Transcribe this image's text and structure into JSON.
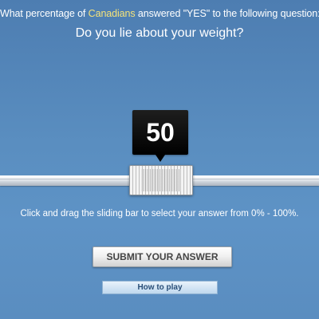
{
  "question": {
    "prefix": "What percentage of ",
    "country": "Canadians",
    "suffix": " answered \"YES\" to the following question:",
    "text": "Do you lie about your weight?"
  },
  "slider": {
    "value": 50,
    "value_label": "50",
    "min": 0,
    "max": 100
  },
  "instruction": "Click and drag the sliding bar to select your answer from 0% - 100%.",
  "buttons": {
    "submit_label": "SUBMIT YOUR ANSWER",
    "how_to_play_label": "How to play"
  },
  "colors": {
    "background": "#5a8ec0",
    "highlight": "#f4e27a",
    "bubble": "#000000"
  }
}
